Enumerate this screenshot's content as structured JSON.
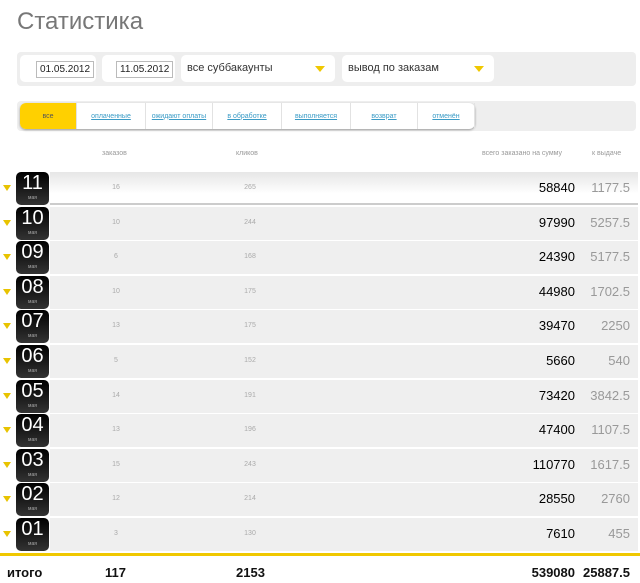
{
  "title": "Статистика",
  "filters": {
    "date_from": "01.05.2012",
    "date_to": "11.05.2012",
    "subaccounts": "все суббакаунты",
    "output": "вывод по заказам"
  },
  "tabs": [
    "все",
    "оплаченные",
    "ожидают оплаты",
    "в обработке",
    "выполняется",
    "возврат",
    "отменён"
  ],
  "headers": {
    "orders": "заказов",
    "clicks": "кликов",
    "sum": "всего заказано на сумму",
    "payout": "к выдаче"
  },
  "rows": [
    {
      "day": "11",
      "month": "мая",
      "orders": "16",
      "clicks": "265",
      "sum": "58840",
      "payout": "1177.5"
    },
    {
      "day": "10",
      "month": "мая",
      "orders": "10",
      "clicks": "244",
      "sum": "97990",
      "payout": "5257.5"
    },
    {
      "day": "09",
      "month": "мая",
      "orders": "6",
      "clicks": "168",
      "sum": "24390",
      "payout": "5177.5"
    },
    {
      "day": "08",
      "month": "мая",
      "orders": "10",
      "clicks": "175",
      "sum": "44980",
      "payout": "1702.5"
    },
    {
      "day": "07",
      "month": "мая",
      "orders": "13",
      "clicks": "175",
      "sum": "39470",
      "payout": "2250"
    },
    {
      "day": "06",
      "month": "мая",
      "orders": "5",
      "clicks": "152",
      "sum": "5660",
      "payout": "540"
    },
    {
      "day": "05",
      "month": "мая",
      "orders": "14",
      "clicks": "191",
      "sum": "73420",
      "payout": "3842.5"
    },
    {
      "day": "04",
      "month": "мая",
      "orders": "13",
      "clicks": "196",
      "sum": "47400",
      "payout": "1107.5"
    },
    {
      "day": "03",
      "month": "мая",
      "orders": "15",
      "clicks": "243",
      "sum": "110770",
      "payout": "1617.5"
    },
    {
      "day": "02",
      "month": "мая",
      "orders": "12",
      "clicks": "214",
      "sum": "28550",
      "payout": "2760"
    },
    {
      "day": "01",
      "month": "мая",
      "orders": "3",
      "clicks": "130",
      "sum": "7610",
      "payout": "455"
    }
  ],
  "total": {
    "label": "итого",
    "orders": "117",
    "clicks": "2153",
    "sum": "539080",
    "payout": "25887.5"
  }
}
